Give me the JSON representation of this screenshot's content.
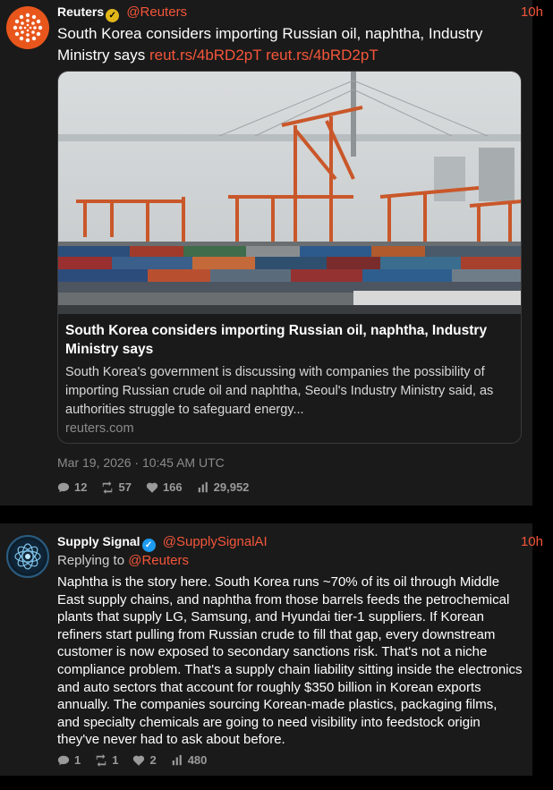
{
  "tweet1": {
    "name": "Reuters",
    "handle": "@Reuters",
    "time": "10h",
    "text": "South Korea considers importing Russian oil, naphtha, Industry Ministry says",
    "links": [
      "reut.rs/4bRD2pT",
      "reut.rs/4bRD2pT"
    ],
    "card": {
      "title": "South Korea considers importing Russian oil, naphtha, Industry Ministry says",
      "description": "South Korea's government is discussing with companies the possibility of importing Russian crude oil and naphtha, Seoul's Industry Ministry said, as authorities struggle to safeguard energy...",
      "domain": "reuters.com",
      "image_icon": "port-container-cranes-photo"
    },
    "date": "Mar 19, 2026 · 10:45 AM UTC",
    "stats": {
      "replies": "12",
      "retweets": "57",
      "likes": "166",
      "views": "29,952"
    }
  },
  "tweet2": {
    "name": "Supply Signal",
    "handle": "@SupplySignalAI",
    "time": "10h",
    "replying_prefix": "Replying to ",
    "replying_handle": "@Reuters",
    "text": "Naphtha is the story here. South Korea runs ~70% of its oil through Middle East supply chains, and naphtha from those barrels feeds the petrochemical plants that supply LG, Samsung, and Hyundai tier-1 suppliers. If Korean refiners start pulling from Russian crude to fill that gap, every downstream customer is now exposed to secondary sanctions risk. That's not a niche compliance problem. That's a supply chain liability sitting inside the electronics and auto sectors that account for roughly $350 billion in Korean exports annually. The companies sourcing Korean-made plastics, packaging films, and specialty chemicals are going to need visibility into feedstock origin they've never had to ask about before.",
    "stats": {
      "replies": "1",
      "retweets": "1",
      "likes": "2",
      "views": "480"
    }
  },
  "colors": {
    "accent": "#f4563a",
    "verified_gold": "#e2b719",
    "verified_blue": "#1d9bf0",
    "background": "#000000",
    "card": "#1a1a1a"
  }
}
